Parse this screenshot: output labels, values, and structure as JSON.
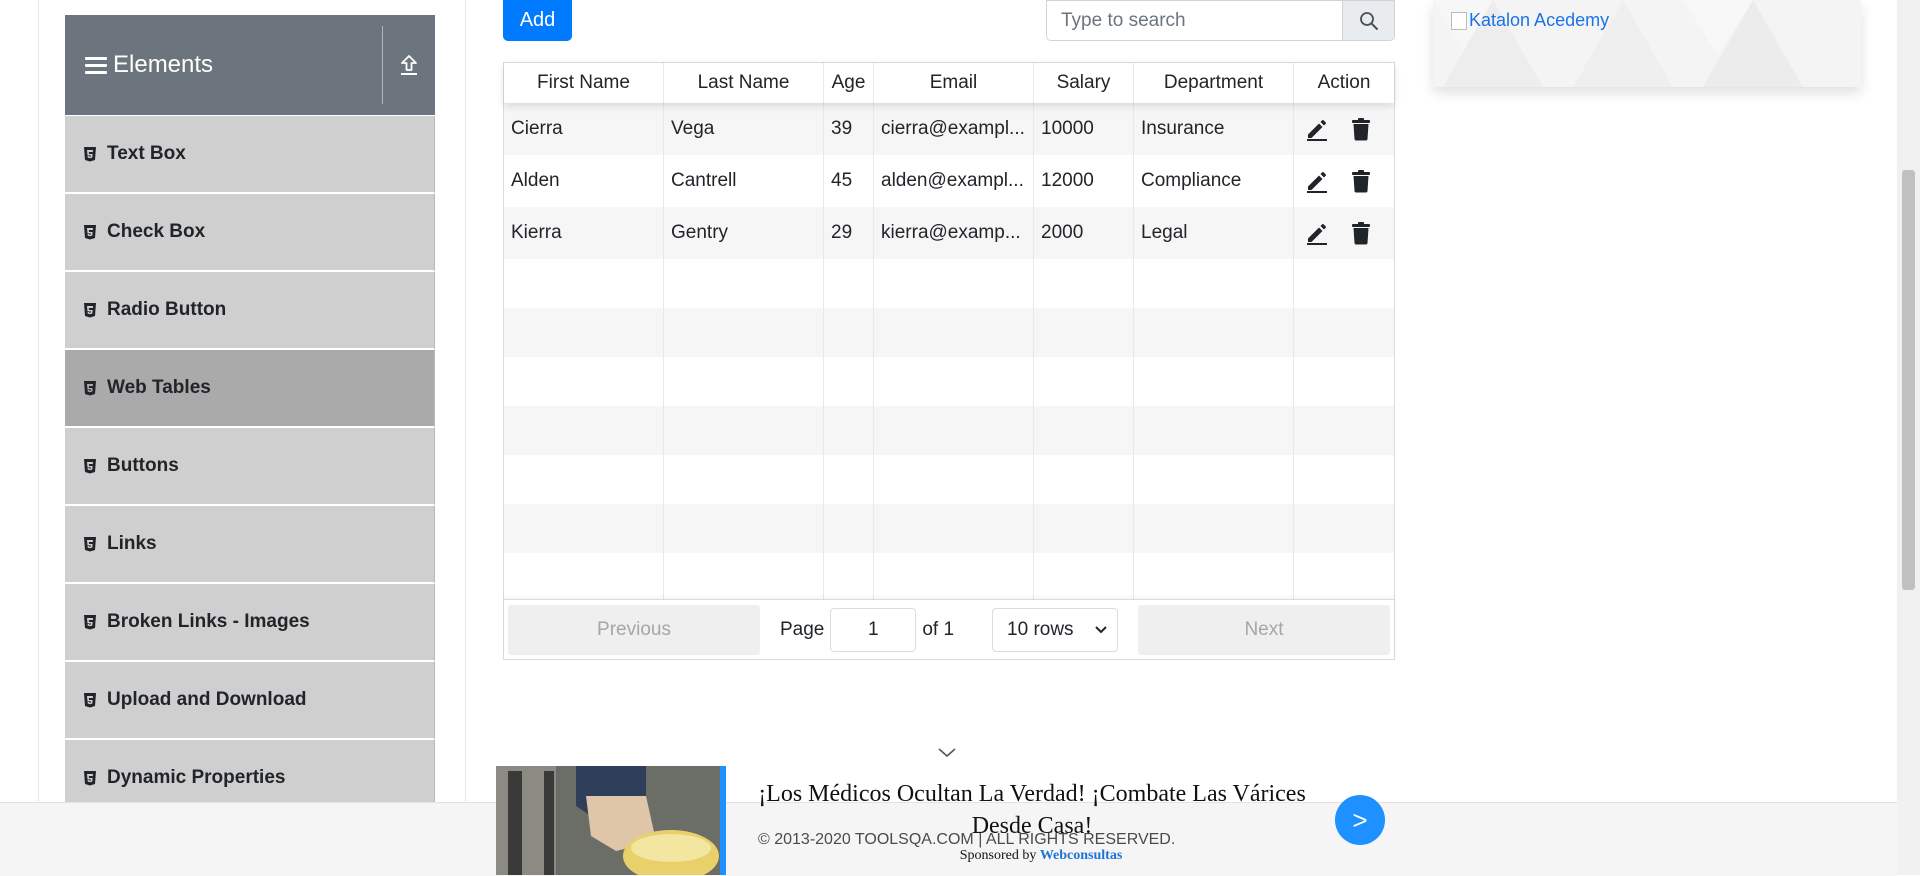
{
  "sidebar": {
    "header": {
      "title": "Elements"
    },
    "items": [
      {
        "label": "Text Box"
      },
      {
        "label": "Check Box"
      },
      {
        "label": "Radio Button"
      },
      {
        "label": "Web Tables"
      },
      {
        "label": "Buttons"
      },
      {
        "label": "Links"
      },
      {
        "label": "Broken Links - Images"
      },
      {
        "label": "Upload and Download"
      },
      {
        "label": "Dynamic Properties"
      }
    ],
    "active_item": "Web Tables"
  },
  "toolbar": {
    "add_label": "Add",
    "search_placeholder": "Type to search",
    "search_icon": "search-icon"
  },
  "table": {
    "headers": [
      "First Name",
      "Last Name",
      "Age",
      "Email",
      "Salary",
      "Department",
      "Action"
    ],
    "rows": [
      {
        "first_name": "Cierra",
        "last_name": "Vega",
        "age": "39",
        "email": "cierra@exampl...",
        "salary": "10000",
        "department": "Insurance"
      },
      {
        "first_name": "Alden",
        "last_name": "Cantrell",
        "age": "45",
        "email": "alden@exampl...",
        "salary": "12000",
        "department": "Compliance"
      },
      {
        "first_name": "Kierra",
        "last_name": "Gentry",
        "age": "29",
        "email": "kierra@examp...",
        "salary": "2000",
        "department": "Legal"
      }
    ],
    "action_icons": [
      "edit-icon",
      "delete-icon"
    ]
  },
  "pagination": {
    "previous_label": "Previous",
    "page_label": "Page",
    "page_value": "1",
    "of_label": "of 1",
    "rows_option": "10 rows",
    "next_label": "Next"
  },
  "right_ad": {
    "link_text": "Katalon Acedemy"
  },
  "footer": {
    "copyright": "© 2013-2020 TOOLSQA.COM | ALL RIGHTS RESERVED."
  },
  "bottom_ad": {
    "headline": "¡Los Médicos Ocultan La Verdad! ¡Combate Las Várices Desde Casa!",
    "sponsored_prefix": "Sponsored by",
    "sponsor_name": "Webconsultas",
    "arrow_label": ">"
  },
  "colors": {
    "primary": "#007bff",
    "header_bg": "#6c757d",
    "menu_bg": "#cfcfcf",
    "menu_active_bg": "#aaaaaa",
    "ad_accent": "#1e90ff"
  }
}
